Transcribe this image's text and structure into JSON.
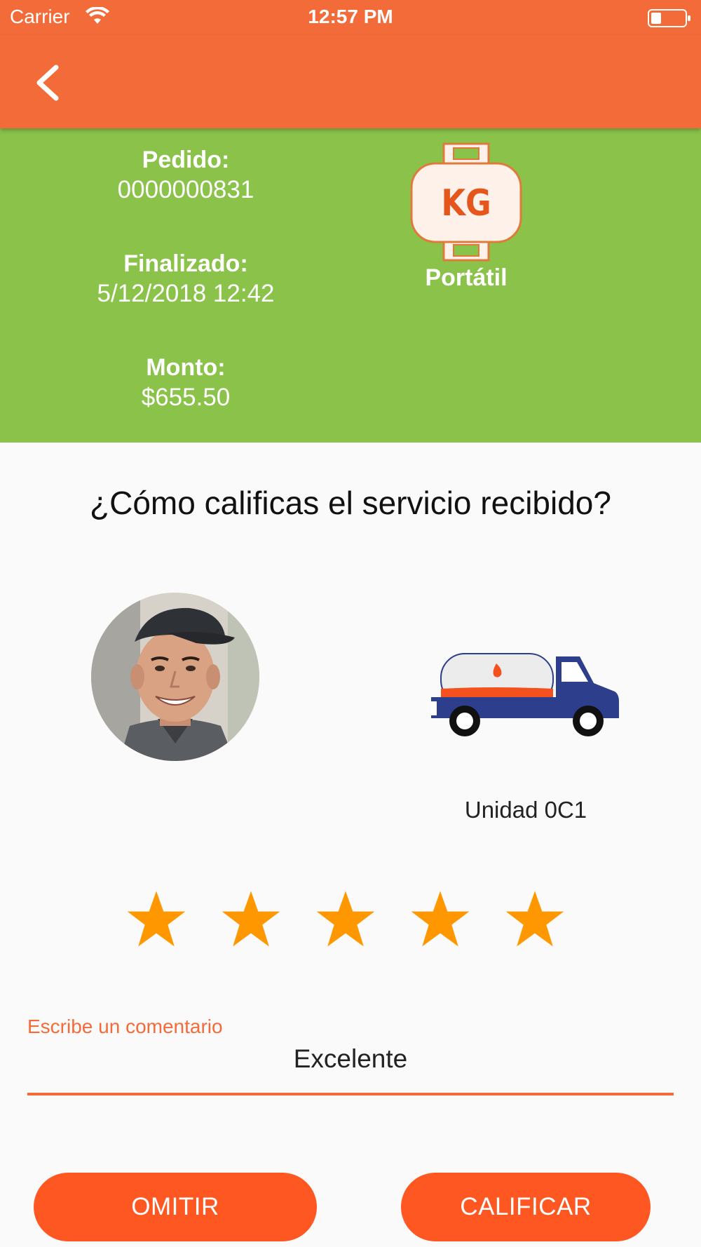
{
  "status_bar": {
    "carrier": "Carrier",
    "time": "12:57 PM"
  },
  "nav": {
    "back_icon": "chevron-left-icon"
  },
  "order": {
    "pedido_label": "Pedido:",
    "pedido_value": "0000000831",
    "finalizado_label": "Finalizado:",
    "finalizado_value": "5/12/2018 12:42",
    "monto_label": "Monto:",
    "monto_value": "$655.50",
    "cylinder_icon": "gas-cylinder-icon",
    "cylinder_text": "KG",
    "type_label": "Portátil"
  },
  "rating": {
    "question": "¿Cómo calificas el servicio recibido?",
    "driver_avatar": "driver-avatar",
    "truck_icon": "gas-truck-icon",
    "unit_label": "Unidad 0C1",
    "stars_max": 5,
    "stars_value": 5
  },
  "comment": {
    "label": "Escribe un comentario",
    "value": "Excelente"
  },
  "buttons": {
    "omit": "OMITIR",
    "rate": "CALIFICAR"
  },
  "colors": {
    "accent": "#f46b3a",
    "summary_bg": "#8bc34a",
    "button": "#ff5722",
    "star": "#ff9800",
    "truck_blue": "#2c3e8c"
  }
}
